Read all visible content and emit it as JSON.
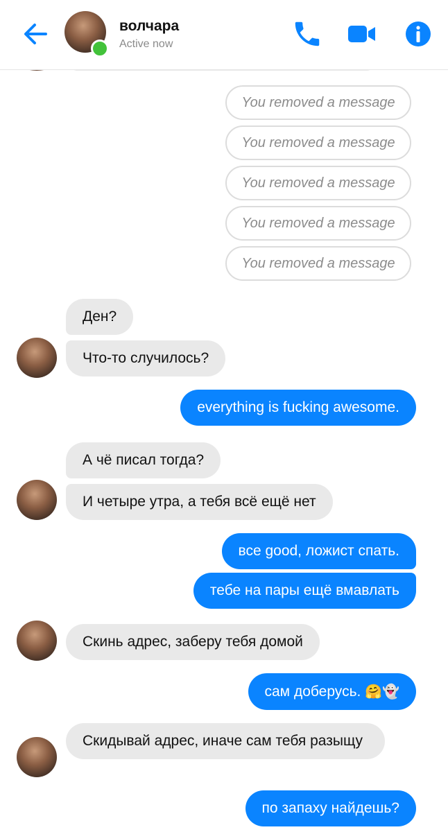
{
  "header": {
    "contact_name": "волчара",
    "status": "Active now",
    "icons": {
      "back": "back-arrow-icon",
      "phone": "phone-icon",
      "video": "video-camera-icon",
      "info": "info-icon"
    },
    "accent_color": "#0a84ff",
    "online_color": "#42c23a"
  },
  "removed_messages": [
    "You removed a message",
    "You removed a message",
    "You removed a message",
    "You removed a message",
    "You removed a message"
  ],
  "messages": [
    {
      "from": "them",
      "text": "Ден?"
    },
    {
      "from": "them",
      "text": "Что-то случилось?"
    },
    {
      "from": "me",
      "text": "everything is fucking awesome."
    },
    {
      "from": "them",
      "text": "А чё писал тогда?"
    },
    {
      "from": "them",
      "text": "И четыре утра, а тебя всё ещё нет"
    },
    {
      "from": "me",
      "text": "все good, ложист спать."
    },
    {
      "from": "me",
      "text": "тебе на пары ещё вмавлать"
    },
    {
      "from": "them",
      "text": "Скинь адрес, заберу тебя домой"
    },
    {
      "from": "me",
      "text": "сам доберусь.",
      "emoji": "🤗👻"
    },
    {
      "from": "them",
      "text": "Скидывай адрес, иначе сам тебя разыщу"
    },
    {
      "from": "me",
      "text": "по запаху найдешь?"
    }
  ],
  "colors": {
    "incoming_bubble": "#e9e9e9",
    "outgoing_bubble": "#0a84ff"
  }
}
